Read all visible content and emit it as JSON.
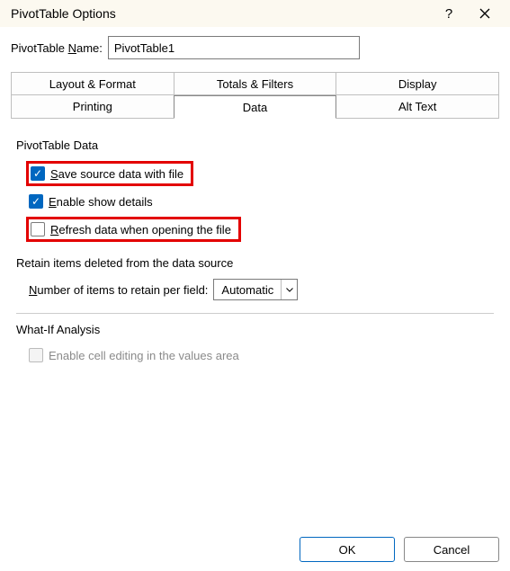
{
  "title": "PivotTable Options",
  "name_label_pre": "PivotTable ",
  "name_label_u": "N",
  "name_label_post": "ame:",
  "name_value": "PivotTable1",
  "tabs": {
    "row1": [
      "Layout & Format",
      "Totals & Filters",
      "Display"
    ],
    "row2": [
      "Printing",
      "Data",
      "Alt Text"
    ],
    "active": "Data"
  },
  "group1": "PivotTable Data",
  "chk_save_u": "S",
  "chk_save_rest": "ave source data with file",
  "chk_save_checked": true,
  "chk_show_u": "E",
  "chk_show_rest": "nable show details",
  "chk_show_checked": true,
  "chk_refresh_u": "R",
  "chk_refresh_rest": "efresh data when opening the file",
  "chk_refresh_checked": false,
  "group2": "Retain items deleted from the data source",
  "retain_u": "N",
  "retain_rest": "umber of items to retain per field:",
  "retain_value": "Automatic",
  "group3": "What-If Analysis",
  "chk_whatif": "Enable cell editing in the values area",
  "chk_whatif_checked": false,
  "ok": "OK",
  "cancel": "Cancel"
}
